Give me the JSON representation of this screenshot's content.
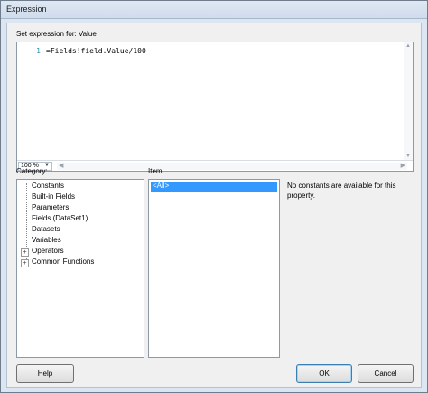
{
  "window": {
    "title": "Expression"
  },
  "expression": {
    "label": "Set expression for: Value",
    "line_number": "1",
    "code": "=Fields!field.Value/100",
    "zoom": "100 %"
  },
  "category": {
    "label": "Category:",
    "items": [
      {
        "label": "Constants",
        "expandable": false
      },
      {
        "label": "Built-in Fields",
        "expandable": false
      },
      {
        "label": "Parameters",
        "expandable": false
      },
      {
        "label": "Fields (DataSet1)",
        "expandable": false
      },
      {
        "label": "Datasets",
        "expandable": false
      },
      {
        "label": "Variables",
        "expandable": false
      },
      {
        "label": "Operators",
        "expandable": true
      },
      {
        "label": "Common Functions",
        "expandable": true
      }
    ]
  },
  "item": {
    "label": "Item:",
    "items": [
      {
        "label": "<All>",
        "selected": true
      }
    ]
  },
  "description": {
    "text": "No constants are available for this property."
  },
  "buttons": {
    "help": "Help",
    "ok": "OK",
    "cancel": "Cancel"
  },
  "colors": {
    "selection": "#3399ff",
    "line_number": "#2b91af"
  }
}
